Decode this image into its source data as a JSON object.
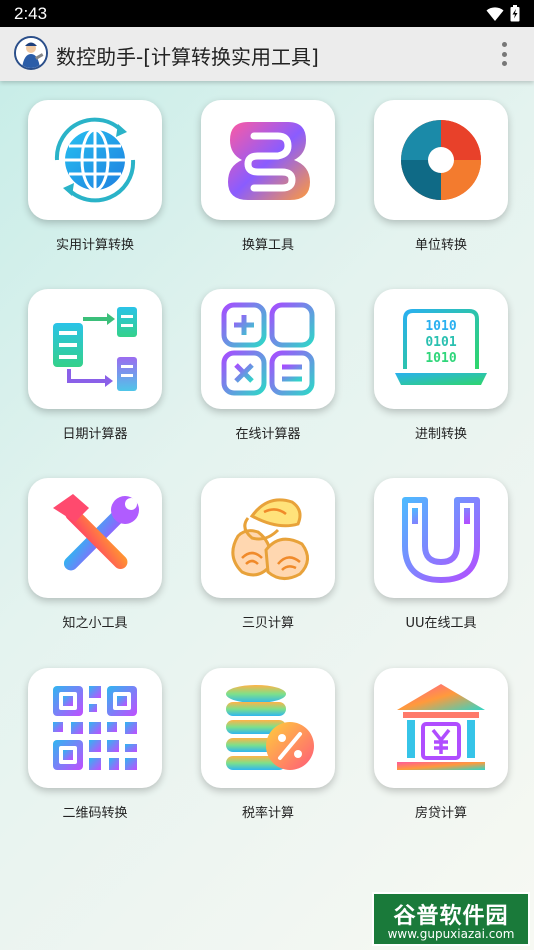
{
  "status_bar": {
    "time": "2:43",
    "wifi_icon": "wifi-icon",
    "battery_icon": "battery-charging-icon"
  },
  "app_bar": {
    "title": "数控助手-[计算转换实用工具]",
    "logo_icon": "mechanic-logo-icon",
    "menu_icon": "more-vertical-icon"
  },
  "tools": [
    {
      "label": "实用计算转换",
      "icon": "globe-sync-icon"
    },
    {
      "label": "换算工具",
      "icon": "double-b-logo-icon"
    },
    {
      "label": "单位转换",
      "icon": "aperture-icon"
    },
    {
      "label": "日期计算器",
      "icon": "flow-list-icon"
    },
    {
      "label": "在线计算器",
      "icon": "calculator-keys-icon"
    },
    {
      "label": "进制转换",
      "icon": "binary-laptop-icon"
    },
    {
      "label": "知之小工具",
      "icon": "hammer-wrench-icon"
    },
    {
      "label": "三贝计算",
      "icon": "shells-icon"
    },
    {
      "label": "UU在线工具",
      "icon": "magnet-icon"
    },
    {
      "label": "二维码转换",
      "icon": "qr-code-icon"
    },
    {
      "label": "税率计算",
      "icon": "coins-percent-icon"
    },
    {
      "label": "房贷计算",
      "icon": "bank-yuan-icon"
    }
  ],
  "watermark": {
    "title": "谷普软件园",
    "url": "www.gupuxiazai.com"
  }
}
